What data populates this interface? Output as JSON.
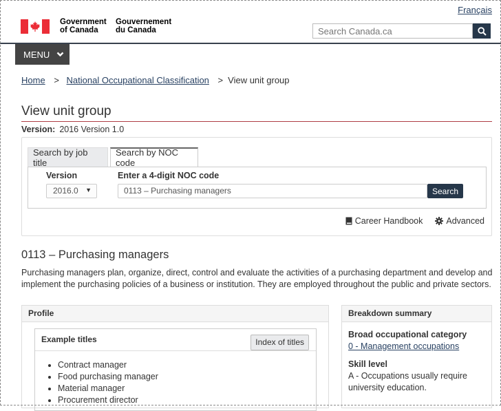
{
  "header": {
    "language_link": "Français",
    "brand_en": [
      "Government",
      "of Canada"
    ],
    "brand_fr": [
      "Gouvernement",
      "du Canada"
    ],
    "search_placeholder": "Search Canada.ca",
    "menu_label": "MENU"
  },
  "breadcrumb": {
    "home": "Home",
    "noc": "National Occupational Classification",
    "current": "View unit group",
    "separator": ">"
  },
  "page": {
    "title": "View unit group",
    "version_label": "Version:",
    "version_value": "2016 Version 1.0"
  },
  "search_panel": {
    "tabs": [
      "Search by job title",
      "Search by NOC code"
    ],
    "version_label": "Version",
    "version_selected": "2016.0",
    "noc_label": "Enter a 4-digit NOC code",
    "noc_value": "0113 – Purchasing managers",
    "search_button": "Search",
    "career_handbook": "Career Handbook",
    "advanced": "Advanced"
  },
  "unit_group": {
    "heading": "0113 – Purchasing managers",
    "description": "Purchasing managers plan, organize, direct, control and evaluate the activities of a purchasing department and develop and implement the purchasing policies of a business or institution. They are employed throughout the public and private sectors."
  },
  "profile": {
    "heading": "Profile",
    "example_titles_heading": "Example titles",
    "index_button": "Index of titles",
    "titles": [
      "Contract manager",
      "Food purchasing manager",
      "Material manager",
      "Procurement director"
    ]
  },
  "breakdown": {
    "heading": "Breakdown summary",
    "broad_category_label": "Broad occupational category",
    "broad_category_value": "0 - Management occupations",
    "skill_level_label": "Skill level",
    "skill_level_value": "A - Occupations usually require university education."
  },
  "colors": {
    "navy": "#26374a",
    "flag_red": "#eb2d37",
    "title_rule": "#af3c43",
    "link": "#284162"
  }
}
